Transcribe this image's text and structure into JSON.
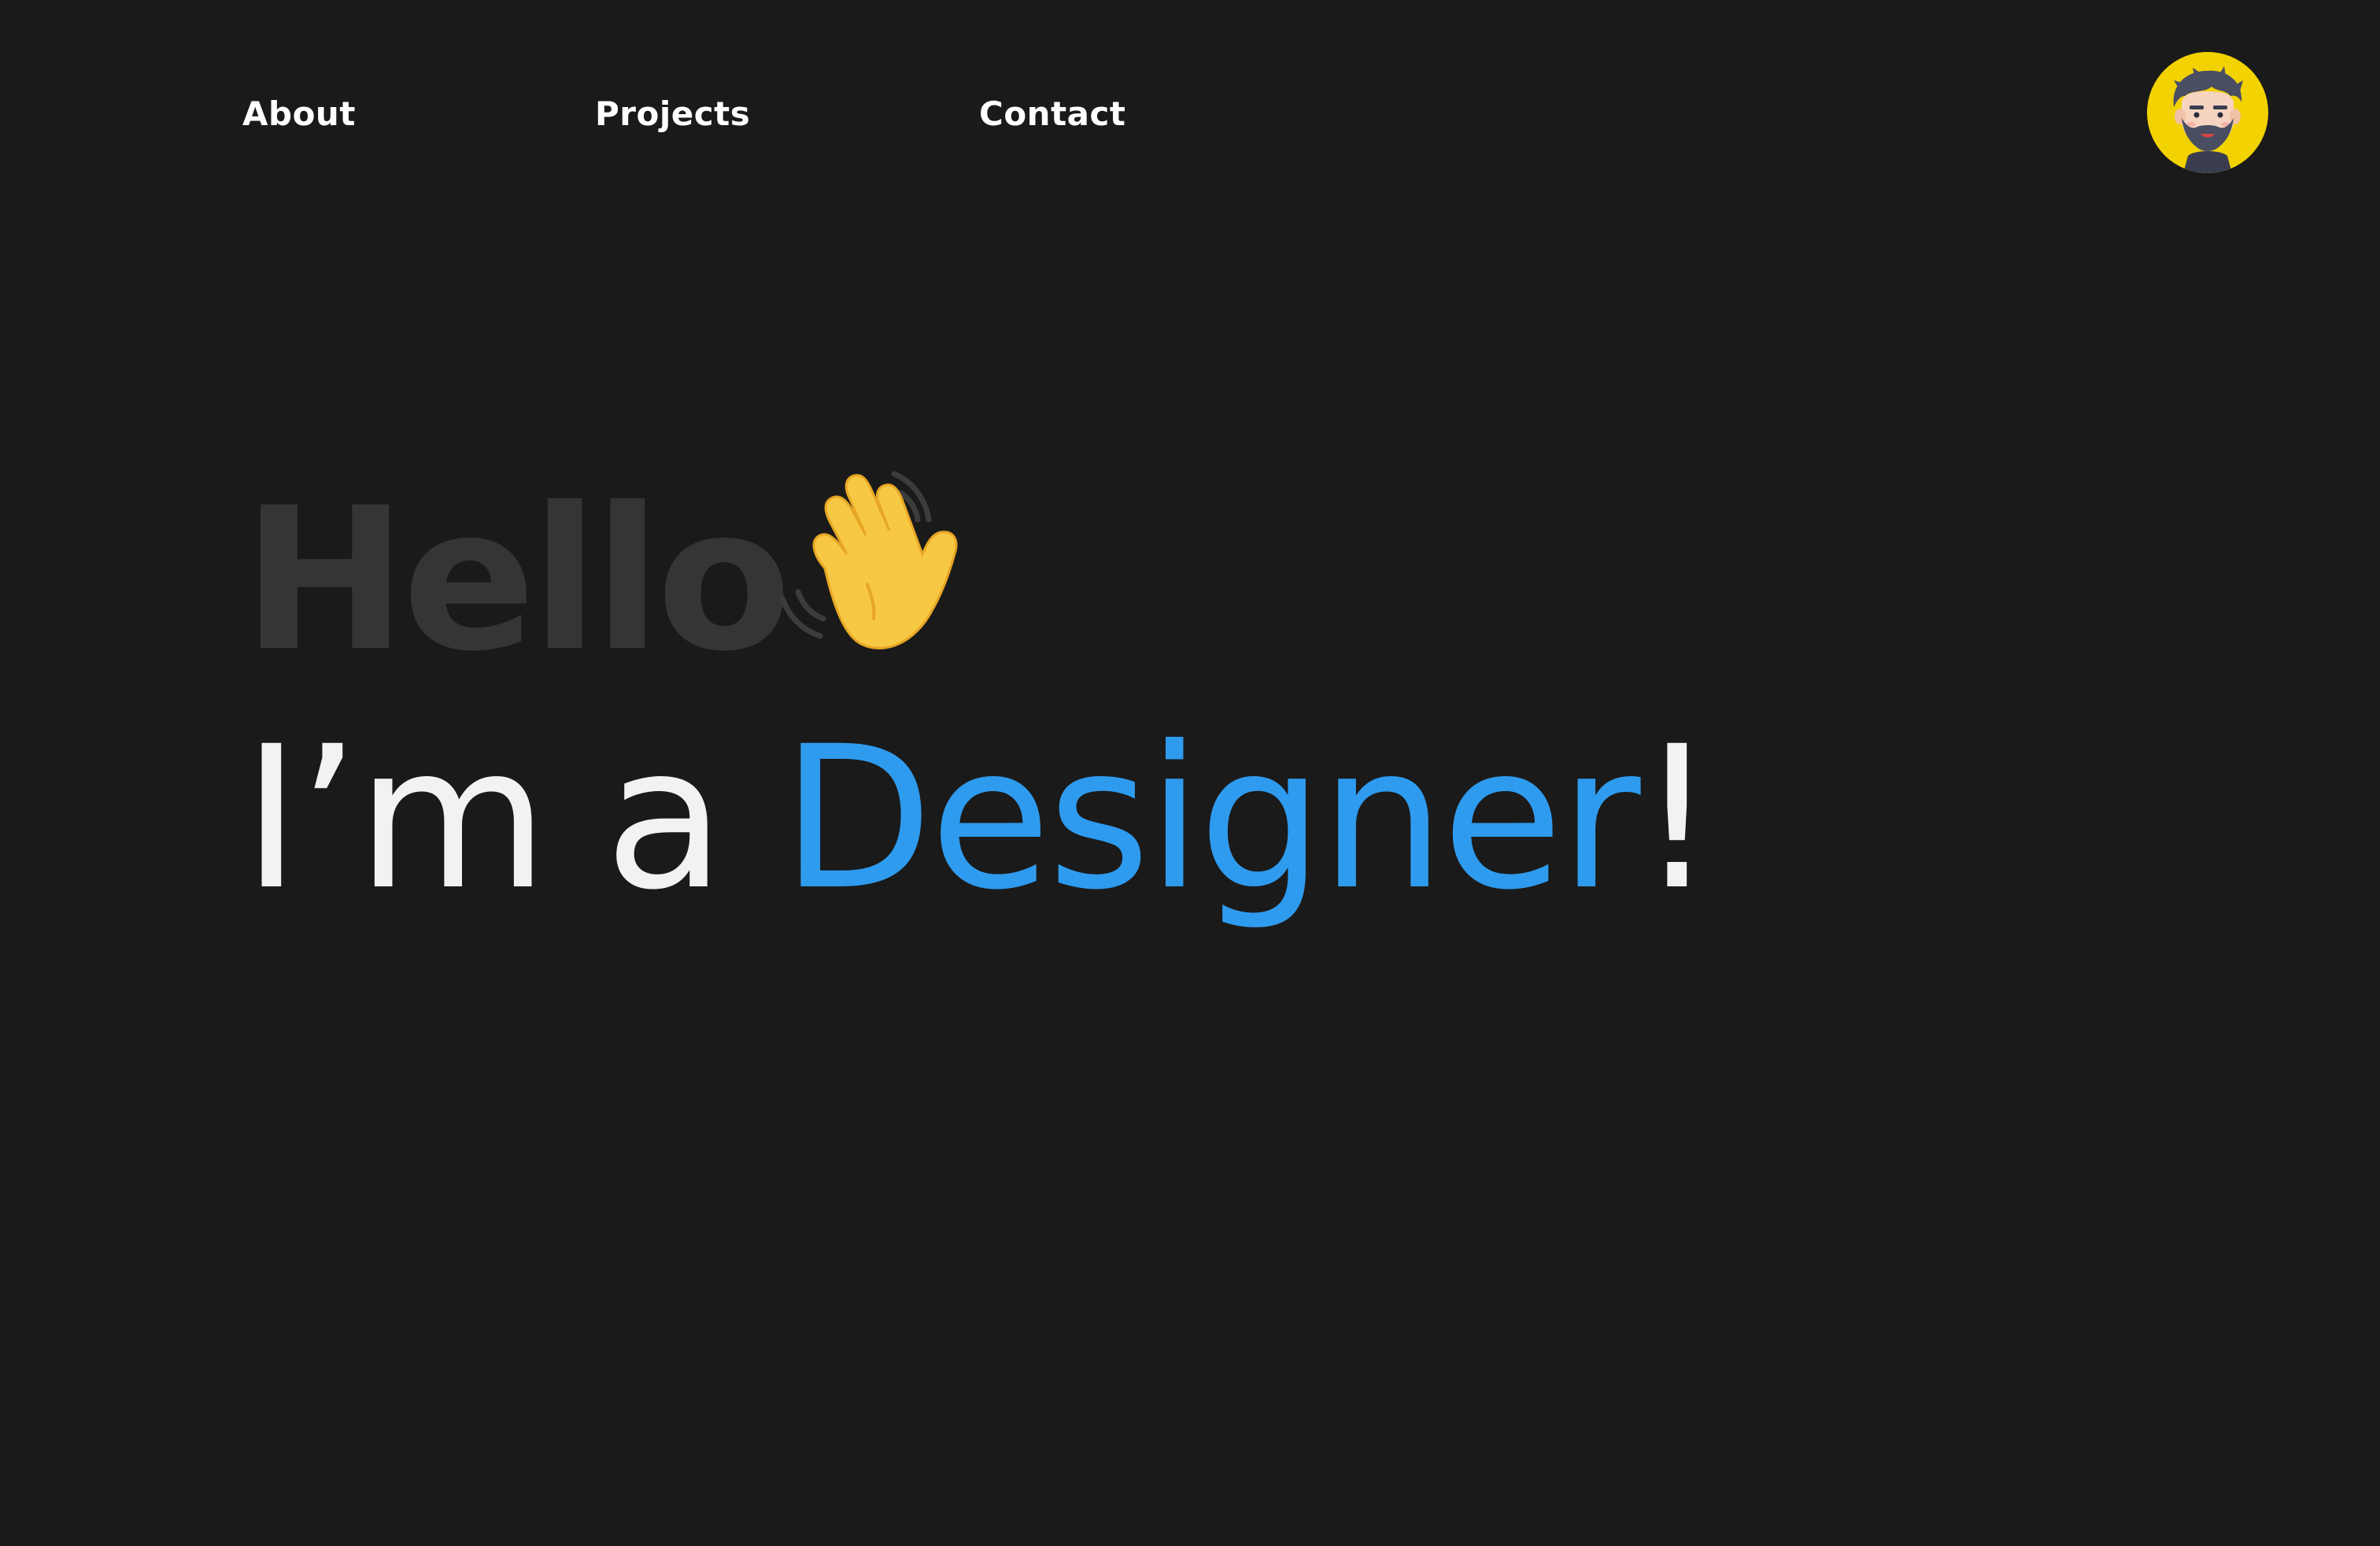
{
  "nav": {
    "items": [
      {
        "label": "About"
      },
      {
        "label": "Projects"
      },
      {
        "label": "Contact"
      }
    ]
  },
  "avatar": {
    "icon": "bearded-man-avatar-icon",
    "background": "#f2d200"
  },
  "hero": {
    "greeting": "Hello",
    "greeting_icon": "waving-hand-icon",
    "line_prefix": "I’m a ",
    "highlight": "Designer",
    "line_suffix": "!"
  },
  "colors": {
    "background": "#1a1a1a",
    "greeting": "#353535",
    "text": "#f2f2f2",
    "accent": "#2f9bef",
    "avatar": "#f2d200"
  }
}
